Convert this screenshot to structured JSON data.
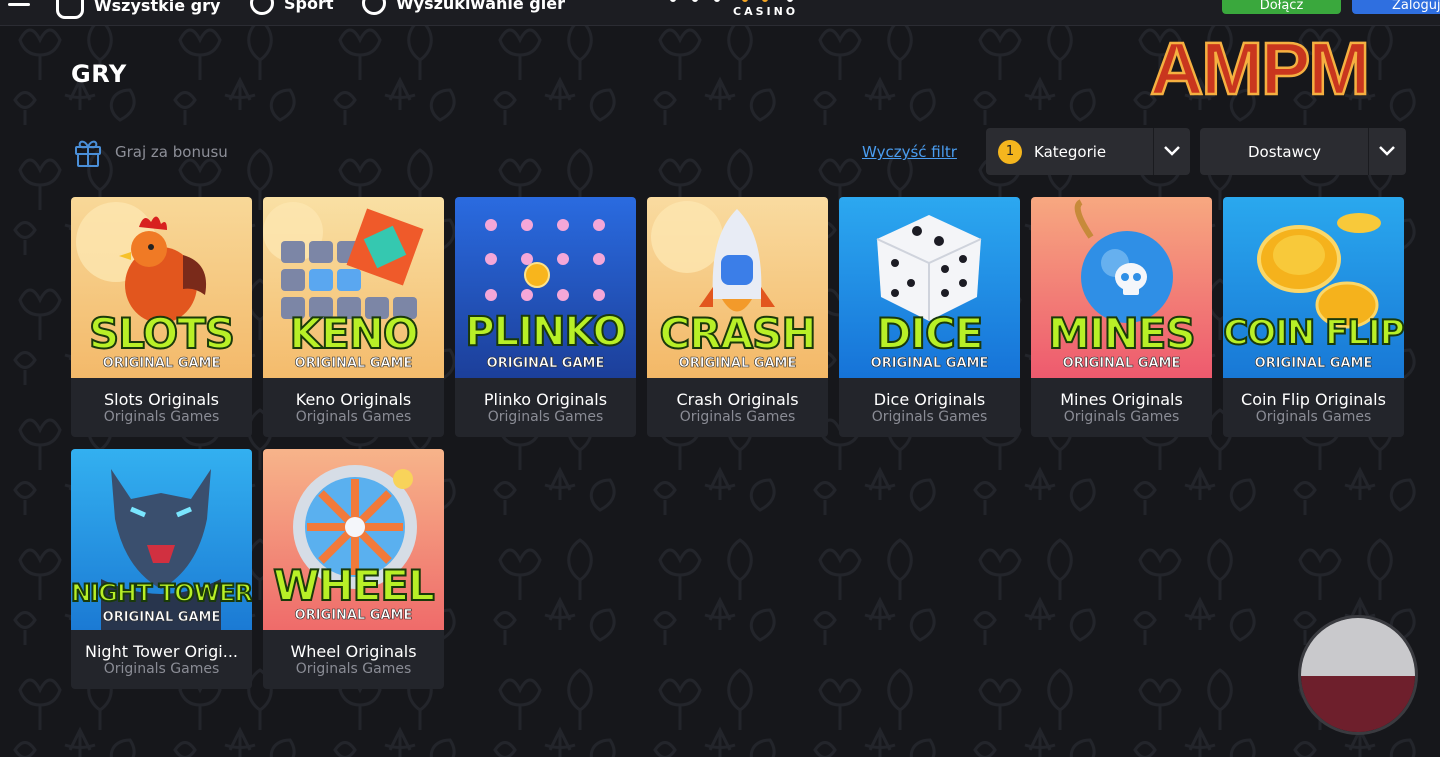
{
  "topbar": {
    "nav": [
      "Wszystkie gry",
      "Sport",
      "Wyszukiwanie gier"
    ],
    "logo_sub": "CASINO",
    "btn_green": "Dołącz",
    "btn_blue": "Zaloguj"
  },
  "page": {
    "title": "GRY"
  },
  "watermark": "AMPM",
  "filters": {
    "bonus_label": "Graj za bonusu",
    "clear_label": "Wyczyść filtr",
    "category": {
      "count": "1",
      "label": "Kategorie"
    },
    "providers": {
      "label": "Dostawcy"
    }
  },
  "games": [
    {
      "name": "Slots Originals",
      "provider": "Originals Games",
      "art_title": "SLOTS",
      "art_sub": "ORIGINAL GAME",
      "bg": "#f6c97a"
    },
    {
      "name": "Keno Originals",
      "provider": "Originals Games",
      "art_title": "KENO",
      "art_sub": "ORIGINAL GAME",
      "bg": "#f8d28a"
    },
    {
      "name": "Plinko Originals",
      "provider": "Originals Games",
      "art_title": "PLINKO",
      "art_sub": "ORIGINAL GAME",
      "bg": "#1f56c8"
    },
    {
      "name": "Crash Originals",
      "provider": "Originals Games",
      "art_title": "CRASH",
      "art_sub": "ORIGINAL GAME",
      "bg": "#f6c57a"
    },
    {
      "name": "Dice Originals",
      "provider": "Originals Games",
      "art_title": "DICE",
      "art_sub": "ORIGINAL GAME",
      "bg": "#1a8ae8"
    },
    {
      "name": "Mines Originals",
      "provider": "Originals Games",
      "art_title": "MINES",
      "art_sub": "ORIGINAL GAME",
      "bg": "#f27a5e"
    },
    {
      "name": "Coin Flip Originals",
      "provider": "Originals Games",
      "art_title": "COIN FLIP",
      "art_sub": "ORIGINAL GAME",
      "bg": "#1d8ee6"
    },
    {
      "name": "Night Tower Origi...",
      "provider": "Originals Games",
      "art_title": "NIGHT TOWER",
      "art_sub": "ORIGINAL GAME",
      "bg": "#2a9ae6"
    },
    {
      "name": "Wheel Originals",
      "provider": "Originals Games",
      "art_title": "WHEEL",
      "art_sub": "ORIGINAL GAME",
      "bg": "#f08a78"
    }
  ]
}
